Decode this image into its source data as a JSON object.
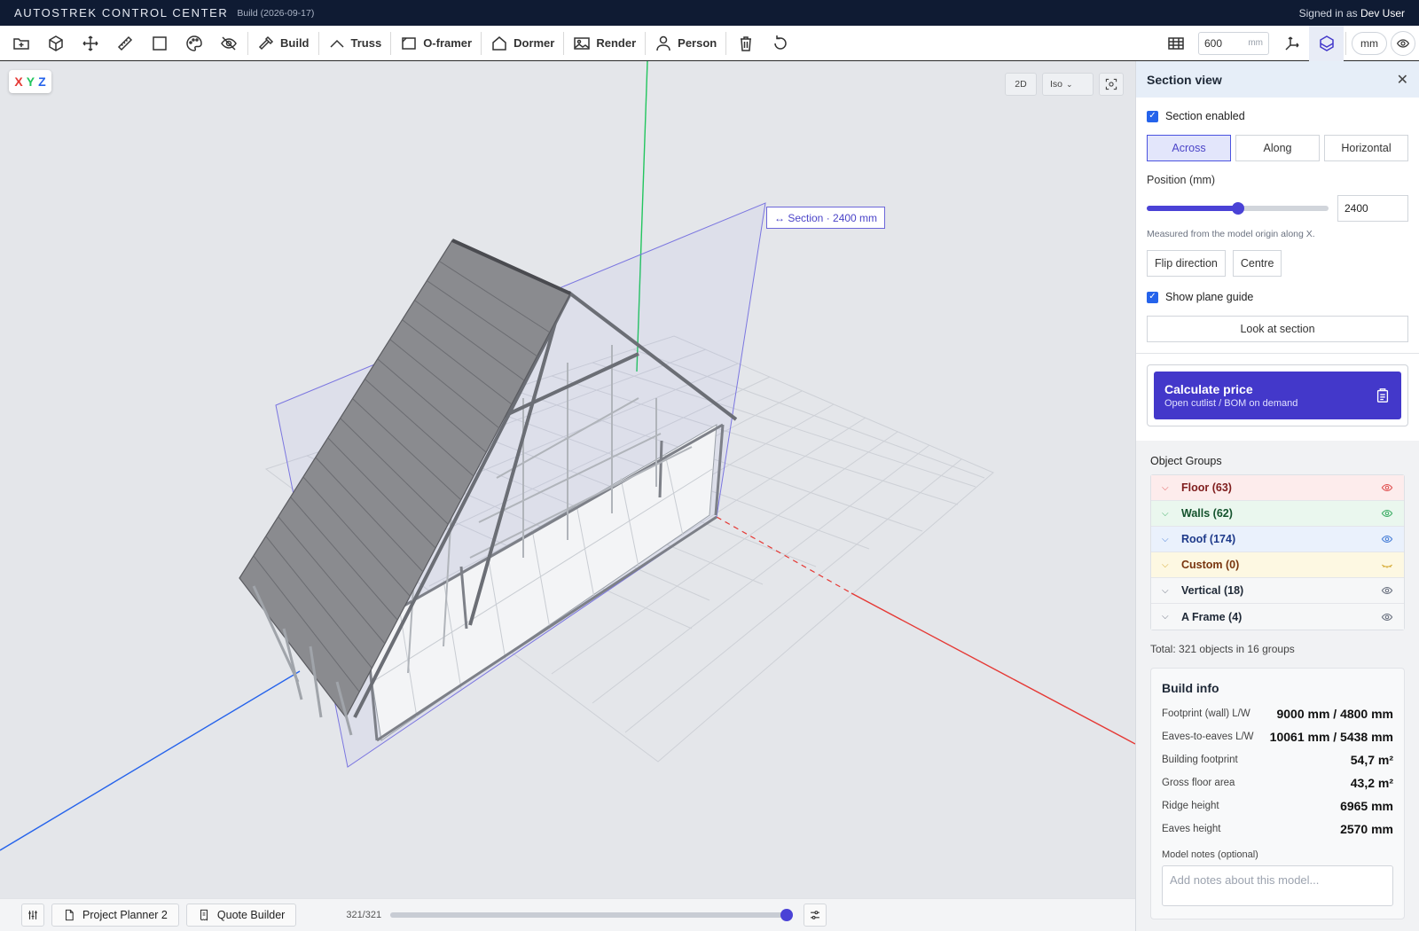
{
  "app": {
    "title": "AUTOSTREK CONTROL CENTER",
    "build": "Build (2026-09-17)",
    "signed_in_prefix": "Signed in as",
    "user": "Dev User"
  },
  "toolbar": {
    "build_label": "Build",
    "truss_label": "Truss",
    "oframer_label": "O-framer",
    "dormer_label": "Dormer",
    "render_label": "Render",
    "person_label": "Person",
    "grid_size_value": "600",
    "grid_size_unit": "mm",
    "units_label": "mm"
  },
  "viewport": {
    "axes_x": "X",
    "axes_y": "Y",
    "axes_z": "Z",
    "view_2d_label": "2D",
    "view_mode": "Iso",
    "section_label": "↔ Section · 2400 mm"
  },
  "section_panel": {
    "title": "Section view",
    "section_enabled_label": "Section enabled",
    "section_enabled": true,
    "orientation_options": [
      "Across",
      "Along",
      "Horizontal"
    ],
    "orientation_selected": "Across",
    "position_label": "Position (mm)",
    "position_value": "2400",
    "position_fraction": 0.5,
    "hint": "Measured from the model origin along X.",
    "flip_label": "Flip direction",
    "centre_label": "Centre",
    "show_guide_label": "Show plane guide",
    "show_guide": true,
    "look_label": "Look at section"
  },
  "calculate": {
    "title": "Calculate price",
    "subtitle": "Open cutlist / BOM on demand"
  },
  "object_groups": {
    "title": "Object Groups",
    "groups": [
      {
        "label": "Floor (63)",
        "color": "#7f1d1d",
        "bg": "#fdecec",
        "eye": "#e05252"
      },
      {
        "label": "Walls (62)",
        "color": "#14532d",
        "bg": "#eaf7ee",
        "eye": "#3fae66"
      },
      {
        "label": "Roof (174)",
        "color": "#1e3a8a",
        "bg": "#eaf1fc",
        "eye": "#4a80d8"
      },
      {
        "label": "Custom (0)",
        "color": "#78350f",
        "bg": "#fdf8e2",
        "eye": "#d4a72c"
      },
      {
        "label": "Vertical (18)",
        "color": "#1f2937",
        "bg": "#f6f7f8",
        "eye": "#6b7280"
      },
      {
        "label": "A Frame (4)",
        "color": "#1f2937",
        "bg": "#f6f7f8",
        "eye": "#6b7280"
      }
    ],
    "total": "Total: 321 objects in 16 groups"
  },
  "build_info": {
    "title": "Build info",
    "rows": [
      {
        "k": "Footprint (wall) L/W",
        "v": "9000 mm / 4800 mm"
      },
      {
        "k": "Eaves-to-eaves L/W",
        "v": "10061 mm / 5438 mm"
      },
      {
        "k": "Building footprint",
        "v": "54,7 m²"
      },
      {
        "k": "Gross floor area",
        "v": "43,2 m²"
      },
      {
        "k": "Ridge height",
        "v": "6965 mm"
      },
      {
        "k": "Eaves height",
        "v": "2570 mm"
      }
    ],
    "notes_label": "Model notes (optional)",
    "notes_placeholder": "Add notes about this model..."
  },
  "bottombar": {
    "planner_label": "Project Planner 2",
    "quote_label": "Quote Builder",
    "count": "321/321",
    "slider_fraction": 1.0
  },
  "colors": {
    "accent": "#4338ca",
    "axis_x": "#e53935",
    "axis_y": "#22c55e",
    "axis_z": "#2563eb"
  }
}
